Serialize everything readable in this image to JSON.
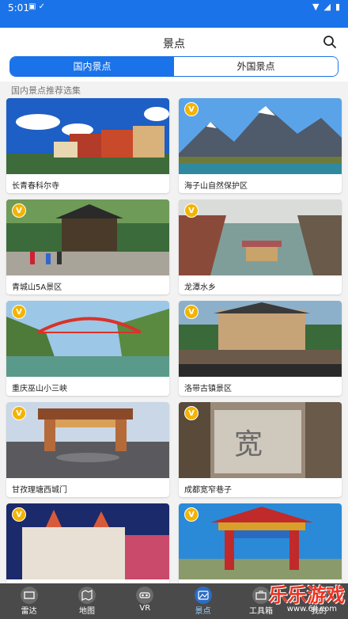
{
  "status": {
    "time": "5:01"
  },
  "header": {
    "title": "景点"
  },
  "tabs": [
    {
      "label": "国内景点"
    },
    {
      "label": "外国景点"
    }
  ],
  "section_title": "国内景点推荐选集",
  "cards": [
    {
      "caption": "长青春科尔寺"
    },
    {
      "caption": "海子山自然保护区",
      "badge": "V"
    },
    {
      "caption": "青城山5A景区",
      "badge": "V"
    },
    {
      "caption": "龙潭水乡",
      "badge": "V"
    },
    {
      "caption": "重庆巫山小三峡",
      "badge": "V"
    },
    {
      "caption": "洛带古镇景区",
      "badge": "V"
    },
    {
      "caption": "甘孜理塘西城门",
      "badge": "V"
    },
    {
      "caption": "成都宽窄巷子",
      "badge": "V"
    },
    {
      "caption": "",
      "badge": "V"
    },
    {
      "caption": "",
      "badge": "V"
    }
  ],
  "nav": [
    {
      "label": "雷达",
      "icon": "radar-icon"
    },
    {
      "label": "地图",
      "icon": "map-icon"
    },
    {
      "label": "VR",
      "icon": "vr-icon"
    },
    {
      "label": "景点",
      "icon": "scenic-icon"
    },
    {
      "label": "工具箱",
      "icon": "toolbox-icon"
    },
    {
      "label": "我的",
      "icon": "profile-icon"
    }
  ],
  "watermark": {
    "text": "乐乐游戏",
    "sub": "www.6ll.com"
  },
  "colors": {
    "accent": "#1a73e8",
    "badge": "#f3b400",
    "nav_bg": "#4a4a4a"
  }
}
